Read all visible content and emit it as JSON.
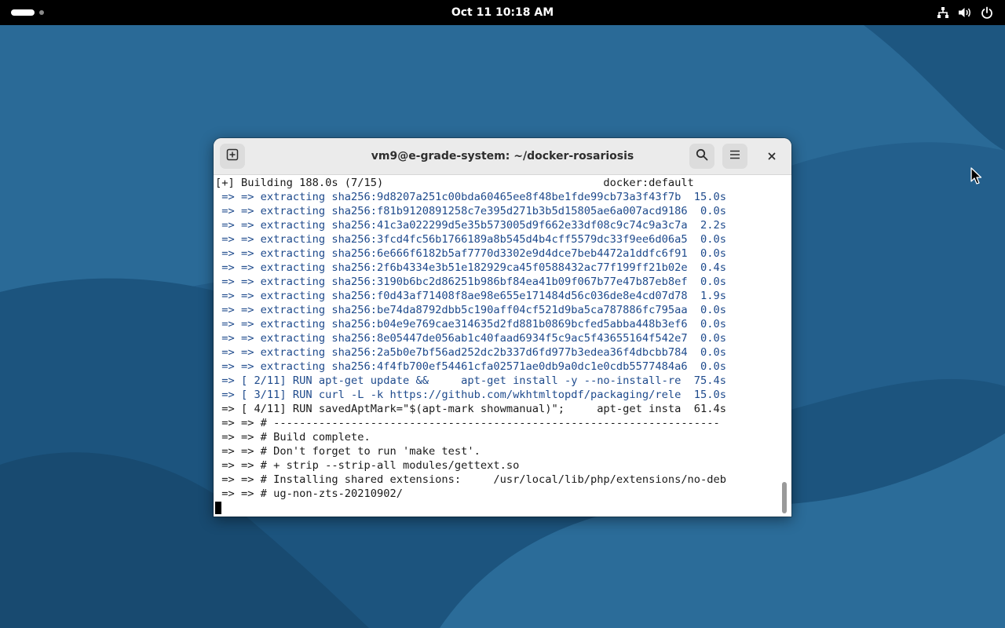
{
  "topbar": {
    "clock": "Oct 11  10:18 AM",
    "icons": [
      "activities-pill",
      "network-icon",
      "volume-icon",
      "power-icon"
    ]
  },
  "window": {
    "title": "vm9@e-grade-system: ~/docker-rosariosis",
    "buttons": {
      "new_tab_icon": "new-tab-icon",
      "search_icon": "search-icon",
      "menu_icon": "hamburger-menu-icon",
      "close_icon": "close-icon"
    }
  },
  "terminal": {
    "lines": [
      {
        "text": "[+] Building 188.0s (7/15)                                  docker:default",
        "style": "dark"
      },
      {
        "text": " => => extracting sha256:9d8207a251c00bda60465ee8f48be1fde99cb73a3f43f7b  15.0s",
        "style": "blue"
      },
      {
        "text": " => => extracting sha256:f81b9120891258c7e395d271b3b5d15805ae6a007acd9186  0.0s",
        "style": "blue"
      },
      {
        "text": " => => extracting sha256:41c3a022299d5e35b573005d9f662e33df08c9c74c9a3c7a  2.2s",
        "style": "blue"
      },
      {
        "text": " => => extracting sha256:3fcd4fc56b1766189a8b545d4b4cff5579dc33f9ee6d06a5  0.0s",
        "style": "blue"
      },
      {
        "text": " => => extracting sha256:6e666f6182b5af7770d3302e9d4dce7beb4472a1ddfc6f91  0.0s",
        "style": "blue"
      },
      {
        "text": " => => extracting sha256:2f6b4334e3b51e182929ca45f0588432ac77f199ff21b02e  0.4s",
        "style": "blue"
      },
      {
        "text": " => => extracting sha256:3190b6bc2d86251b986bf84ea41b09f067b77e47b87eb8ef  0.0s",
        "style": "blue"
      },
      {
        "text": " => => extracting sha256:f0d43af71408f8ae98e655e171484d56c036de8e4cd07d78  1.9s",
        "style": "blue"
      },
      {
        "text": " => => extracting sha256:be74da8792dbb5c190aff04cf521d9ba5ca787886fc795aa  0.0s",
        "style": "blue"
      },
      {
        "text": " => => extracting sha256:b04e9e769cae314635d2fd881b0869bcfed5abba448b3ef6  0.0s",
        "style": "blue"
      },
      {
        "text": " => => extracting sha256:8e05447de056ab1c40faad6934f5c9ac5f43655164f542e7  0.0s",
        "style": "blue"
      },
      {
        "text": " => => extracting sha256:2a5b0e7bf56ad252dc2b337d6fd977b3edea36f4dbcbb784  0.0s",
        "style": "blue"
      },
      {
        "text": " => => extracting sha256:4f4fb700ef54461cfa02571ae0db9a0dc1e0cdb5577484a6  0.0s",
        "style": "blue"
      },
      {
        "text": " => [ 2/11] RUN apt-get update &&     apt-get install -y --no-install-re  75.4s",
        "style": "blue"
      },
      {
        "text": " => [ 3/11] RUN curl -L -k https://github.com/wkhtmltopdf/packaging/rele  15.0s",
        "style": "blue"
      },
      {
        "text": " => [ 4/11] RUN savedAptMark=\"$(apt-mark showmanual)\";     apt-get insta  61.4s",
        "style": "dark"
      },
      {
        "text": " => => # ---------------------------------------------------------------------",
        "style": "dark"
      },
      {
        "text": " => => # Build complete.",
        "style": "dark"
      },
      {
        "text": " => => # Don't forget to run 'make test'.",
        "style": "dark"
      },
      {
        "text": " => => # + strip --strip-all modules/gettext.so",
        "style": "dark"
      },
      {
        "text": " => => # Installing shared extensions:     /usr/local/lib/php/extensions/no-deb",
        "style": "dark"
      },
      {
        "text": " => => # ug-non-zts-20210902/",
        "style": "dark"
      }
    ]
  },
  "colors": {
    "desktop_bg": "#1f5a86",
    "topbar_bg": "#000000",
    "term_blue": "#1e4a8c",
    "term_text": "#1a1a1a"
  }
}
